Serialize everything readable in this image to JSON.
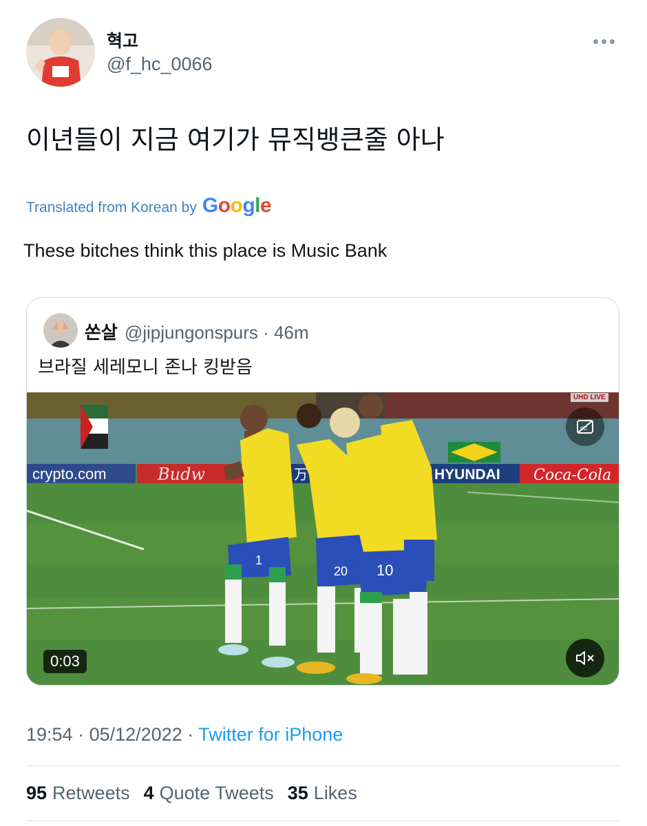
{
  "tweet": {
    "author": {
      "display_name": "혁고",
      "handle": "@f_hc_0066",
      "avatar": "avatar-photo"
    },
    "text": "이년들이 지금 여기가 뮤직뱅큰줄 아나",
    "translation": {
      "label": "Translated from Korean by",
      "provider": [
        "G",
        "o",
        "o",
        "g",
        "l",
        "e"
      ],
      "provider_colors": [
        "#4285F4",
        "#EA4335",
        "#FBBC05",
        "#4285F4",
        "#34A853",
        "#EA4335"
      ],
      "text": "These bitches think this place is Music Bank"
    },
    "quoted_tweet": {
      "display_name": "쏜살",
      "handle": "@jipjungonspurs",
      "age": "· 46m",
      "text": "브라질 세레모니 존나 킹받음",
      "video": {
        "duration": "0:03",
        "badge": "UHD LIVE",
        "ad_boards": [
          "crypto.com",
          "Budw",
          "万",
          "HYUNDAI",
          "Coca-Cola"
        ],
        "jersey_numbers": [
          "1",
          "20",
          "10"
        ]
      }
    },
    "time": "19:54",
    "date": "05/12/2022",
    "separator": " · ",
    "source": "Twitter for iPhone",
    "stats": {
      "retweets_count": "95",
      "retweets_label": "Retweets",
      "quotes_count": "4",
      "quotes_label": "Quote Tweets",
      "likes_count": "35",
      "likes_label": "Likes"
    }
  },
  "colors": {
    "link": "#1d9bf0",
    "translate_link": "#3b84c4",
    "muted_text": "#536471",
    "pitch": "#4e8a3c",
    "jersey_yellow": "#f2dc23",
    "shorts_blue": "#2a4fb8"
  },
  "icons": {
    "more": "more-horizontal-icon",
    "mute": "speaker-muted-icon",
    "captions": "captions-icon"
  }
}
